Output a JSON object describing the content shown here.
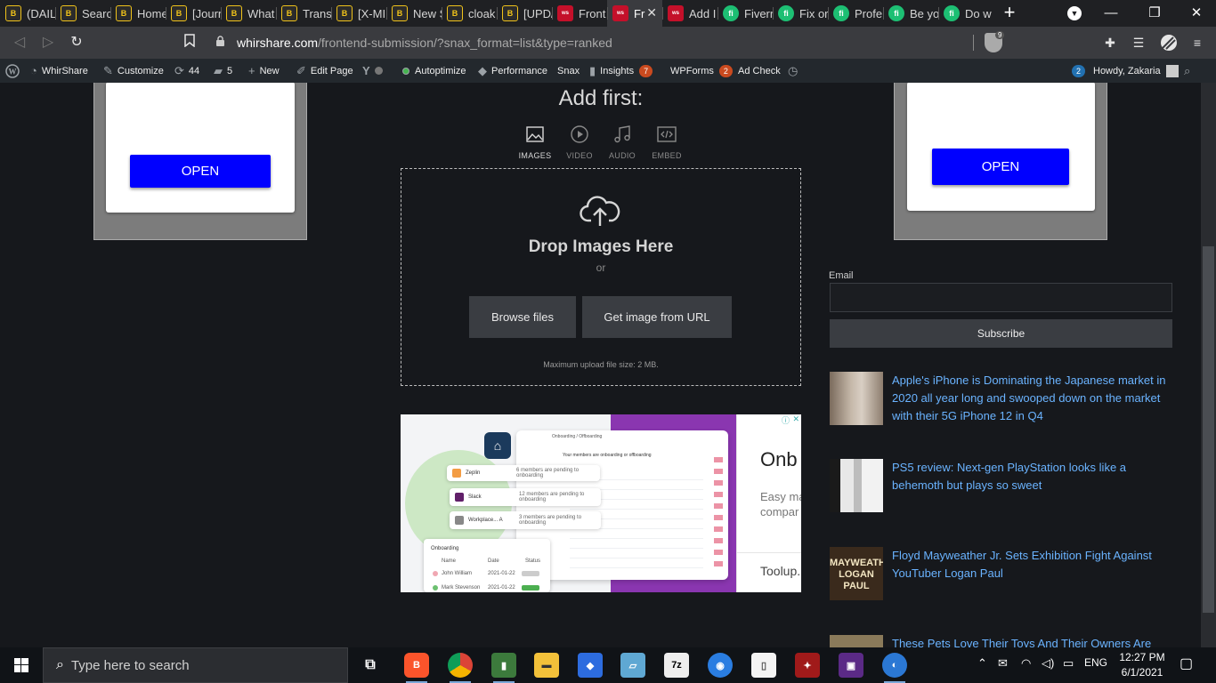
{
  "browser": {
    "tabs": [
      {
        "label": "(DAIL",
        "icon": "bb-icon"
      },
      {
        "label": "Searc",
        "icon": "bb-icon"
      },
      {
        "label": "Home",
        "icon": "bb-icon"
      },
      {
        "label": "[Journ",
        "icon": "bb-icon"
      },
      {
        "label": "What",
        "icon": "bb-icon"
      },
      {
        "label": "Trans",
        "icon": "bb-icon"
      },
      {
        "label": "[X-MI",
        "icon": "bb-icon"
      },
      {
        "label": "New S",
        "icon": "bb-icon"
      },
      {
        "label": "cloak",
        "icon": "bb-icon"
      },
      {
        "label": "[UPD/",
        "icon": "bb-icon"
      },
      {
        "label": "Front",
        "icon": "whirshare-icon"
      },
      {
        "label": "Fr",
        "icon": "whirshare-icon",
        "active": true
      },
      {
        "label": "Add I",
        "icon": "whirshare-icon"
      },
      {
        "label": "Fiverr",
        "icon": "fiverr-icon"
      },
      {
        "label": "Fix or",
        "icon": "fiverr-icon"
      },
      {
        "label": "Profe",
        "icon": "fiverr-icon"
      },
      {
        "label": "Be yo",
        "icon": "fiverr-icon"
      },
      {
        "label": "Do w",
        "icon": "fiverr-icon"
      }
    ],
    "close_glyph": "✕",
    "newtab_glyph": "+",
    "url_domain": "whirshare.com",
    "url_path": "/frontend-submission/?snax_format=list&type=ranked",
    "brave_count": "9"
  },
  "wp_admin_bar": {
    "site_name": "WhirShare",
    "customize": "Customize",
    "updates_count": "44",
    "comments_count": "5",
    "new_label": "New",
    "edit_page": "Edit Page",
    "autoptimize": "Autoptimize",
    "performance": "Performance",
    "snax": "Snax",
    "insights": "Insights",
    "insights_badge": "7",
    "wpforms": "WPForms",
    "wpforms_badge": "2",
    "ad_check": "Ad Check",
    "notif_count": "2",
    "howdy": "Howdy, Zakaria"
  },
  "left_ad": {
    "button": "OPEN"
  },
  "right_ad": {
    "button": "OPEN"
  },
  "uploader": {
    "heading": "Add first:",
    "media_tabs": [
      {
        "label": "IMAGES",
        "icon": "image-icon",
        "selected": true
      },
      {
        "label": "VIDEO",
        "icon": "play-icon"
      },
      {
        "label": "AUDIO",
        "icon": "music-icon"
      },
      {
        "label": "EMBED",
        "icon": "embed-code-icon"
      }
    ],
    "drop_title": "Drop Images Here",
    "or": "or",
    "browse": "Browse files",
    "from_url": "Get image from URL",
    "max_size": "Maximum upload file size: 2 MB."
  },
  "banner_ad": {
    "headline": "Onb",
    "description_line1": "Easy ma",
    "description_line2": "compar",
    "site": "Toolup.",
    "breadcrumb": "Onboarding / Offboarding",
    "members_line": "Your members are onboarding or offboarding",
    "cards": [
      {
        "name": "Zeplin",
        "note": "6 members are pending to onboarding",
        "color": "#f39c43"
      },
      {
        "name": "Slack",
        "note": "12 members are pending to onboarding",
        "color": "#611f69"
      },
      {
        "name": "Workplace... A",
        "note": "3 members are pending to onboarding",
        "color": "#888888"
      }
    ],
    "table_title": "Onboarding",
    "table_cols": [
      "Name",
      "Date",
      "Status"
    ],
    "table_rows": [
      {
        "name": "John William",
        "date": "2021-01-22"
      },
      {
        "name": "Mark Stevenson",
        "date": "2021-01-22"
      }
    ]
  },
  "sidebar": {
    "email_label": "Email",
    "email_value": "",
    "subscribe": "Subscribe",
    "posts": [
      {
        "title": "Apple's iPhone is Dominating the Japanese market in 2020 all year long and swooped down on the market with their 5G iPhone 12 in Q4",
        "thumb": "#8d7d6e"
      },
      {
        "title": "PS5 review: Next-gen PlayStation looks like a behemoth but plays so sweet",
        "thumb": "#c9c9c9"
      },
      {
        "title": "Floyd Mayweather Jr. Sets Exhibition Fight Against YouTuber Logan Paul",
        "thumb": "#3a2a1c"
      },
      {
        "title": "These Pets Love Their Toys And Their Owners Are",
        "thumb": "#8a7a5a"
      }
    ],
    "poster_text": "MAYWEATHER LOGAN PAUL"
  },
  "taskbar": {
    "search_placeholder": "Type here to search",
    "language": "ENG",
    "time": "12:27 PM",
    "date": "6/1/2021"
  }
}
